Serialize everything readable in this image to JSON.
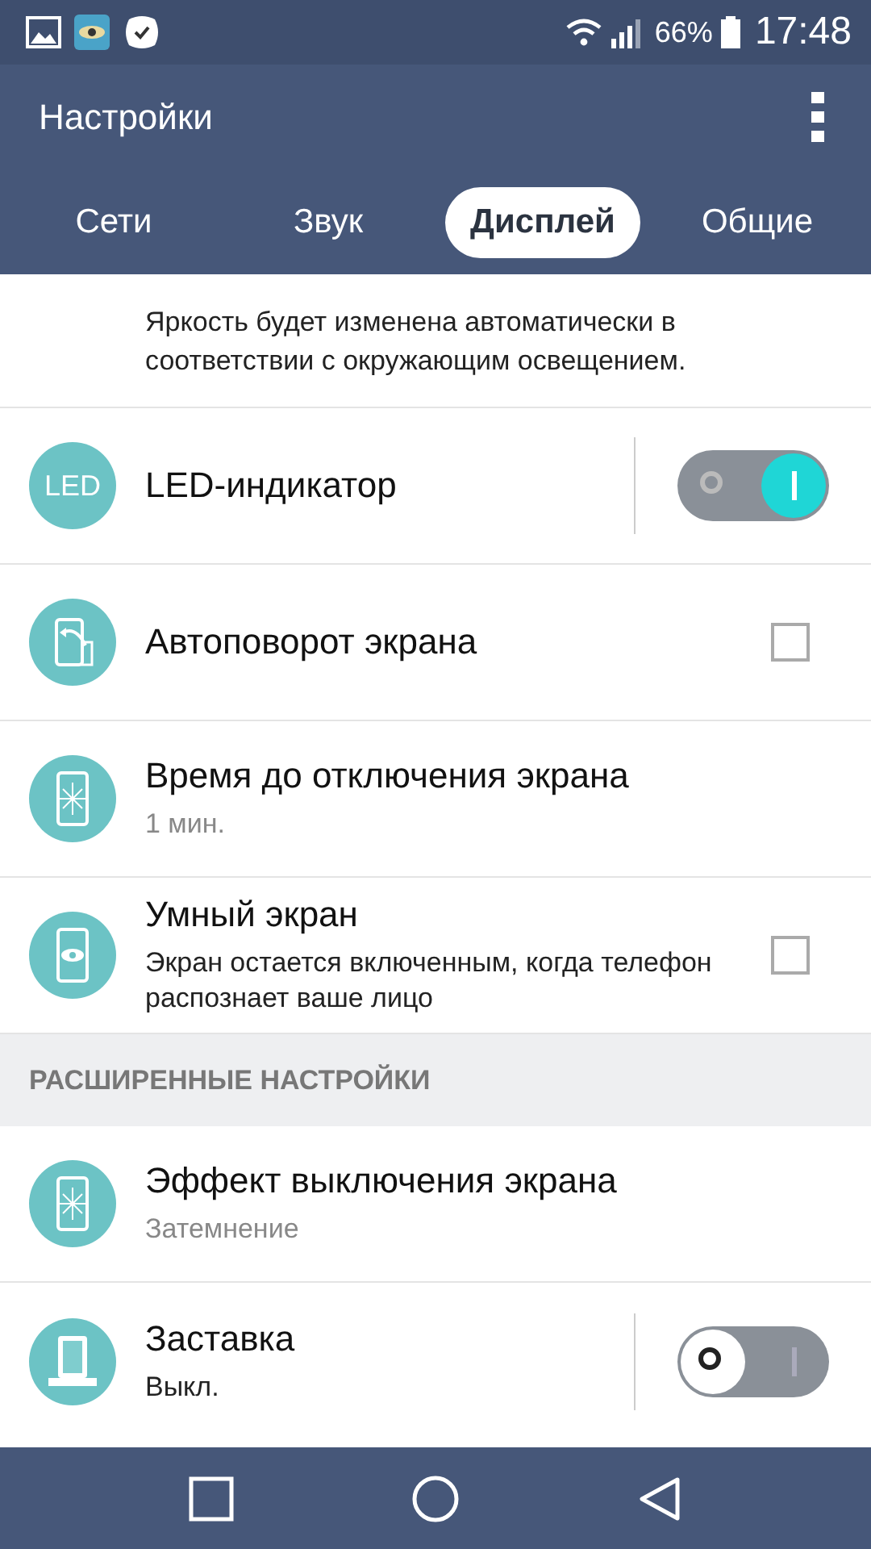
{
  "status_bar": {
    "battery": "66%",
    "time": "17:48"
  },
  "app_bar": {
    "title": "Настройки"
  },
  "tabs": [
    {
      "label": "Сети",
      "selected": false
    },
    {
      "label": "Звук",
      "selected": false
    },
    {
      "label": "Дисплей",
      "selected": true
    },
    {
      "label": "Общие",
      "selected": false
    }
  ],
  "top_note": "Яркость будет изменена автоматически в соответствии с окружающим освещением.",
  "rows": [
    {
      "kind": "switch",
      "title": "LED-индикатор",
      "icon_text": "LED",
      "on": true
    },
    {
      "kind": "checkbox",
      "title": "Автоповорот экрана",
      "checked": false
    },
    {
      "kind": "plain",
      "title": "Время до отключения экрана",
      "summary": "1 мин."
    },
    {
      "kind": "checkbox",
      "title": "Умный экран",
      "summary": "Экран остается включенным, когда телефон распознает ваше лицо",
      "checked": false
    },
    {
      "kind": "section",
      "title": "РАСШИРЕННЫЕ НАСТРОЙКИ"
    },
    {
      "kind": "plain",
      "title": "Эффект выключения экрана",
      "summary": "Затемнение"
    },
    {
      "kind": "switch",
      "title": "Заставка",
      "summary": "Выкл.",
      "on": false
    }
  ]
}
